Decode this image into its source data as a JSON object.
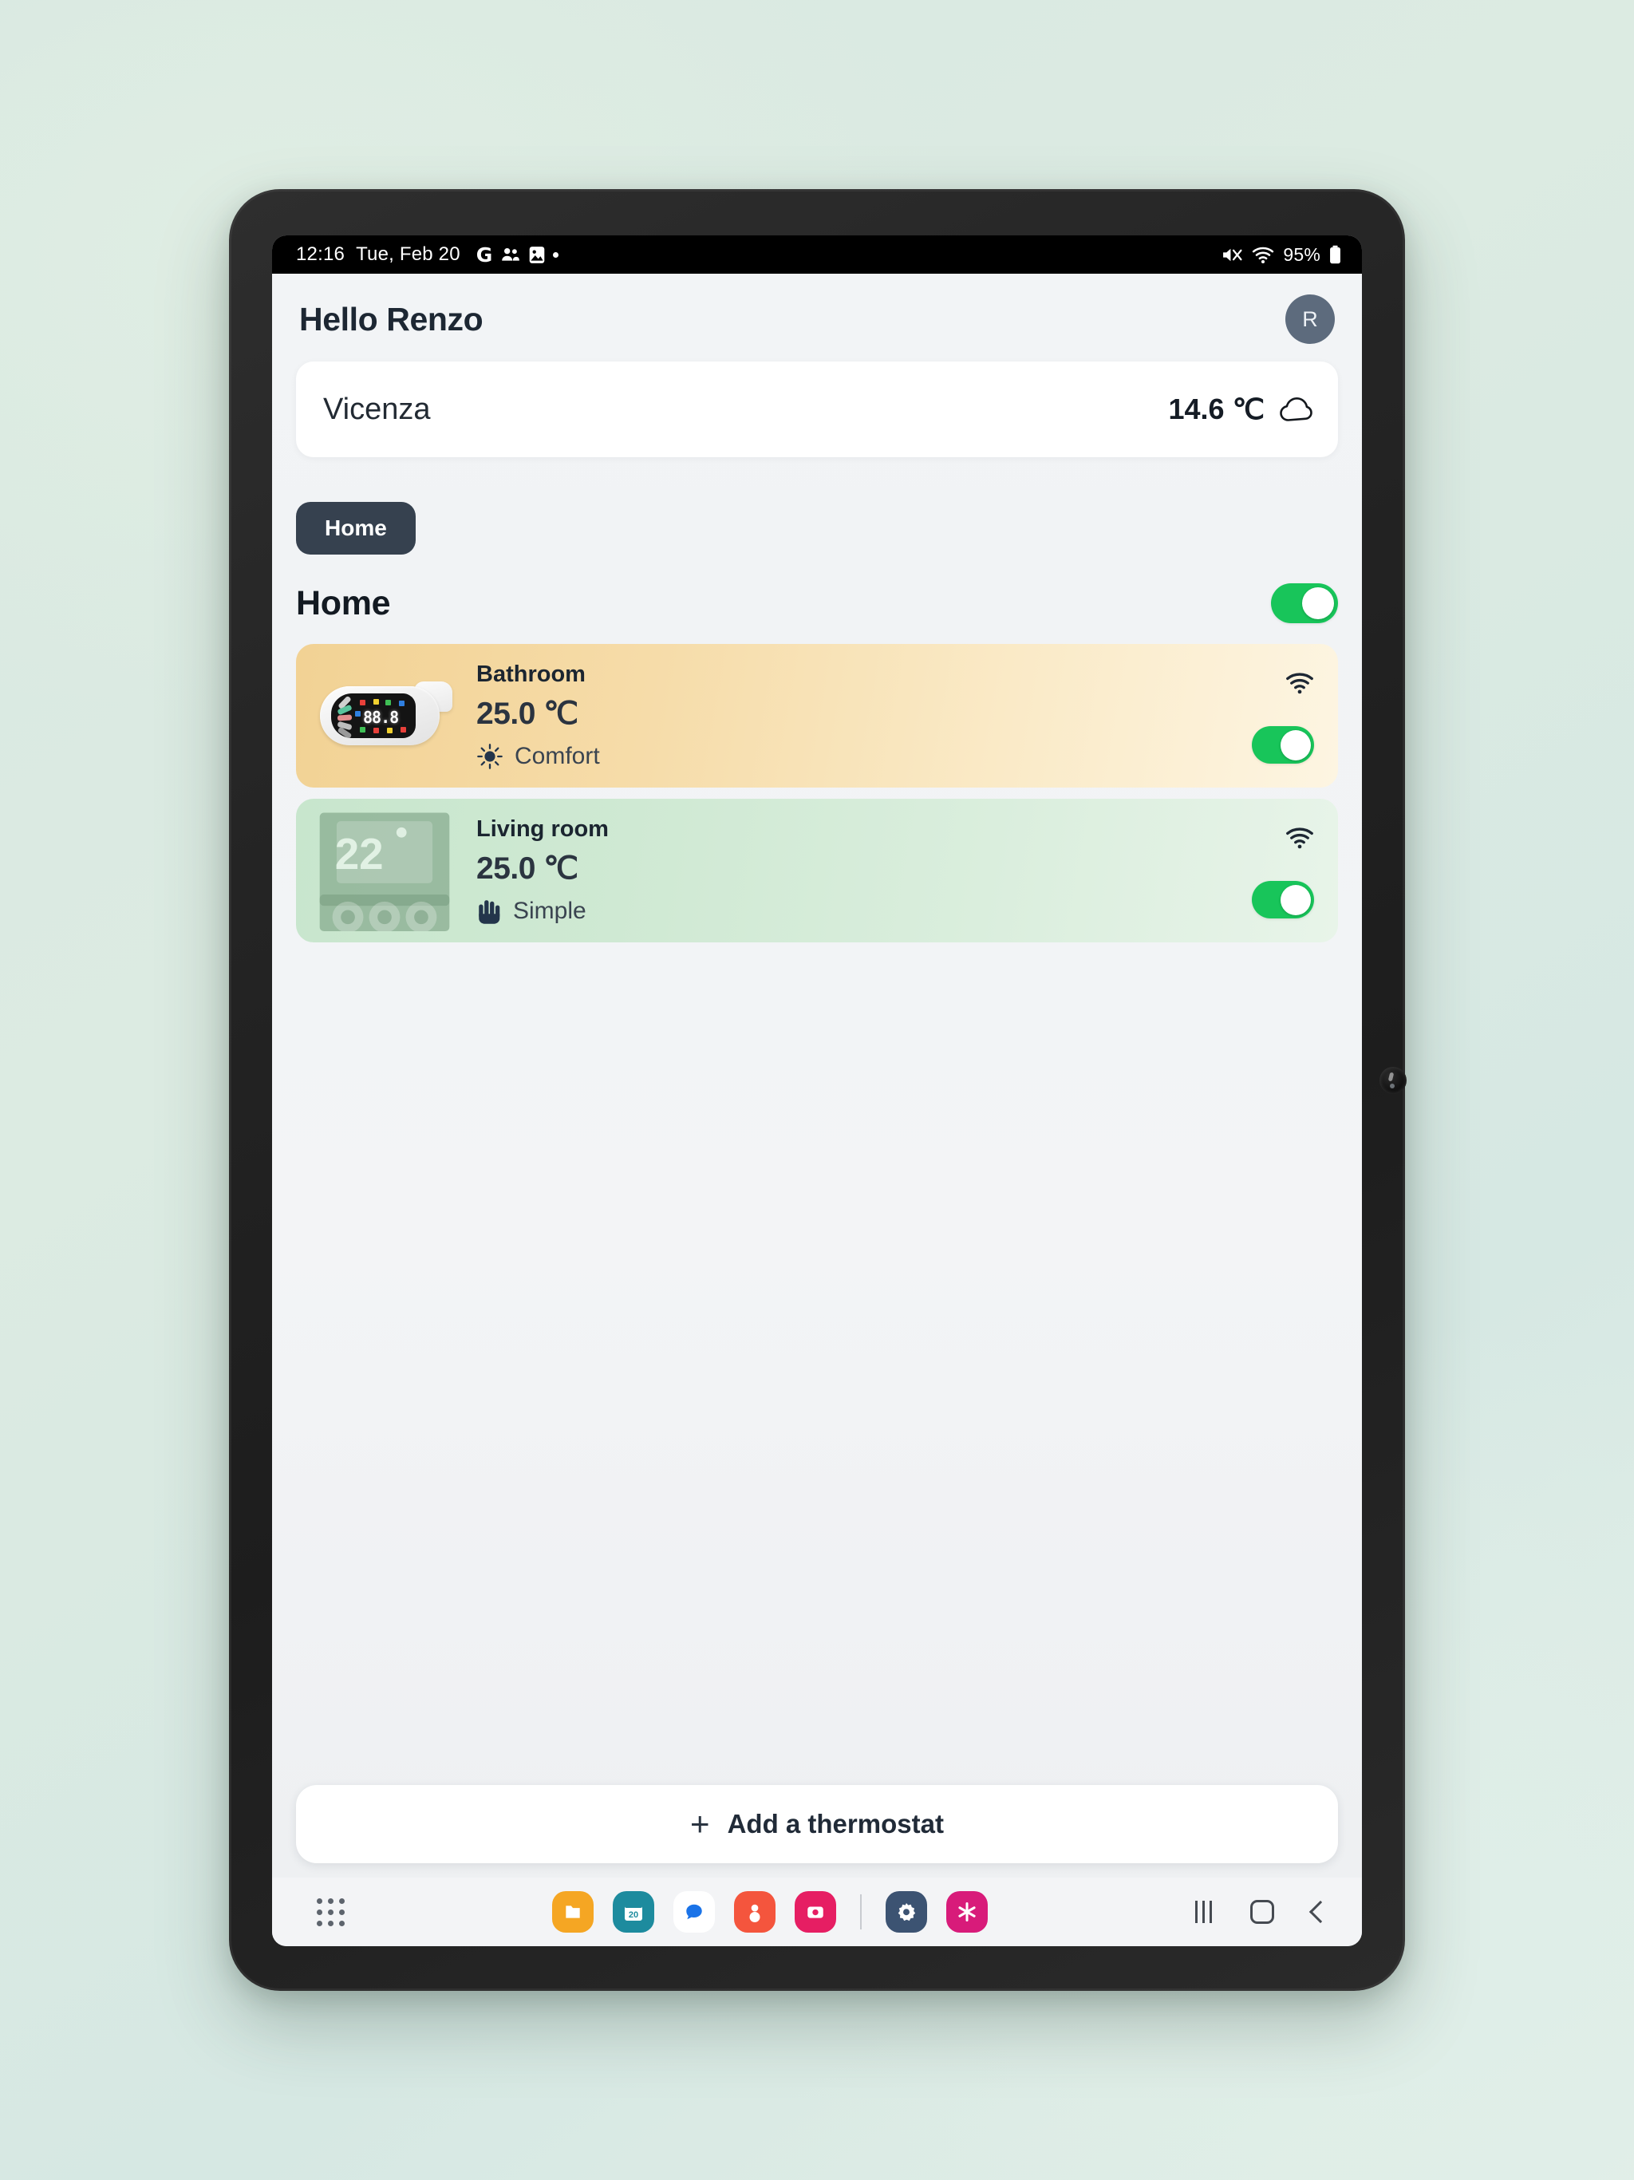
{
  "statusbar": {
    "time": "12:16",
    "date": "Tue, Feb 20",
    "google_icon": "G",
    "contacts_icon": "contacts-icon",
    "photo_icon": "photo-icon",
    "more_dot": "•",
    "mute_icon": "mute-icon",
    "wifi_icon": "wifi-icon",
    "battery_pct": "95%",
    "battery_icon": "battery-icon"
  },
  "header": {
    "greeting": "Hello Renzo",
    "avatar_initial": "R"
  },
  "weather": {
    "city": "Vicenza",
    "temperature": "14.6 ℃",
    "icon": "cloud-icon"
  },
  "chips": [
    {
      "label": "Home",
      "selected": true
    }
  ],
  "section": {
    "title": "Home",
    "master_toggle_on": true
  },
  "devices": [
    {
      "room": "Bathroom",
      "temperature": "25.0 ℃",
      "mode": "Comfort",
      "mode_icon": "sun-icon",
      "wifi_icon": "wifi-icon",
      "toggle_on": true,
      "theme": "amber",
      "thumb": "radiator-valve",
      "display_value": "88.8"
    },
    {
      "room": "Living room",
      "temperature": "25.0 ℃",
      "mode": "Simple",
      "mode_icon": "hand-icon",
      "wifi_icon": "wifi-icon",
      "toggle_on": true,
      "theme": "green",
      "thumb": "thermostat",
      "display_value": "22°"
    }
  ],
  "cta": {
    "plus": "+",
    "label": "Add a thermostat"
  },
  "taskbar": {
    "apps_button": "all-apps-icon",
    "apps": [
      {
        "name": "my-files-icon",
        "color": "#f5a623"
      },
      {
        "name": "calendar-icon",
        "color": "#1d8b9e",
        "badge": "20"
      },
      {
        "name": "messages-icon",
        "color": "#ffffff"
      },
      {
        "name": "contacts-icon",
        "color": "#f4553d"
      },
      {
        "name": "camera-icon",
        "color": "#e61e63"
      },
      {
        "name": "settings-icon",
        "color": "#3c5372"
      },
      {
        "name": "snowflake-icon",
        "color": "#d81b7a"
      }
    ],
    "nav": {
      "recents": "recents-icon",
      "home": "home-icon",
      "back": "back-icon"
    }
  },
  "colors": {
    "accent_green": "#18c55a",
    "chip_navy": "#36414f",
    "amber_card": "#f2d294",
    "green_card": "#c8e6cd",
    "background": "#d8e8e1"
  }
}
